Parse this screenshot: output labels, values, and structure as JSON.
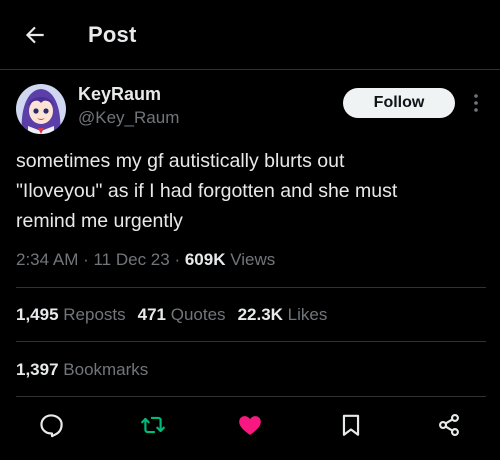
{
  "header": {
    "title": "Post"
  },
  "author": {
    "display_name": "KeyRaum",
    "handle": "@Key_Raum"
  },
  "follow_label": "Follow",
  "tweet": {
    "text_lines": [
      "sometimes my gf autistically blurts out",
      "\"Iloveyou\" as if I had forgotten and she must",
      "remind me urgently"
    ]
  },
  "meta": {
    "time": "2:34 AM",
    "sep1": " · ",
    "date": "11 Dec 23",
    "sep2": " · ",
    "views_count": "609K",
    "views_label": " Views"
  },
  "stats": {
    "reposts_count": "1,495",
    "reposts_label": " Reposts",
    "quotes_count": "471",
    "quotes_label": " Quotes",
    "likes_count": "22.3K",
    "likes_label": " Likes"
  },
  "bookmarks": {
    "count": "1,397",
    "label": " Bookmarks"
  },
  "colors": {
    "repost": "#00ba7c",
    "like": "#f91880",
    "muted": "#71767b",
    "text": "#e7e9ea"
  },
  "icons": [
    "back-arrow-icon",
    "more-icon",
    "reply-icon",
    "repost-icon",
    "like-icon",
    "bookmark-icon",
    "share-icon"
  ]
}
